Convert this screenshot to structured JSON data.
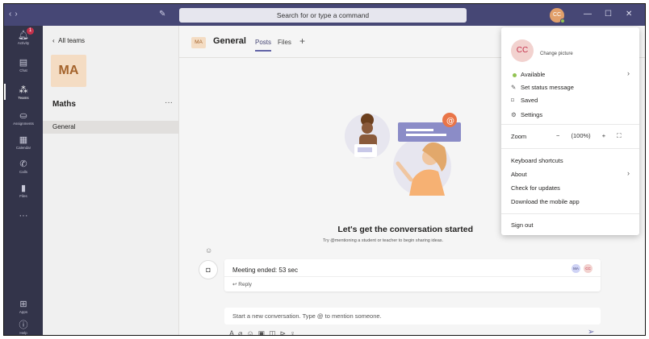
{
  "titlebar": {
    "back_icon": "chevron-left",
    "forward_icon": "chevron-right",
    "compose_icon": "new-chat",
    "search_placeholder": "Search for or type a command",
    "avatar_initials": "CC",
    "status_color": "#92c353"
  },
  "rail": {
    "items": [
      {
        "label": "Activity",
        "icon": "bell",
        "badge": "1"
      },
      {
        "label": "Chat",
        "icon": "chat"
      },
      {
        "label": "Teams",
        "icon": "teams",
        "active": true
      },
      {
        "label": "Assignments",
        "icon": "backpack"
      },
      {
        "label": "Calendar",
        "icon": "calendar"
      },
      {
        "label": "Calls",
        "icon": "phone"
      },
      {
        "label": "Files",
        "icon": "file"
      },
      {
        "label": "More",
        "icon": "ellipsis",
        "text": "···"
      }
    ],
    "bottom": [
      {
        "label": "Apps",
        "icon": "apps"
      },
      {
        "label": "Help",
        "icon": "help"
      }
    ]
  },
  "team_pane": {
    "back_label": "All teams",
    "team_initials": "MA",
    "team_name": "Maths",
    "more_label": "···",
    "channels": [
      "General"
    ]
  },
  "channel": {
    "initials": "MA",
    "title": "General",
    "tabs": [
      "Posts",
      "Files"
    ],
    "active_tab": "Posts",
    "add_tab_label": "+"
  },
  "empty_state": {
    "title": "Let's get the conversation started",
    "subtitle": "Try @mentioning a student or teacher to begin sharing ideas."
  },
  "conversation": {
    "meeting_text": "Meeting ended: 53 sec",
    "reply_label": "Reply",
    "participants": [
      "MA",
      "CC"
    ]
  },
  "compose": {
    "placeholder": "Start a new conversation. Type @ to mention someone."
  },
  "profile_menu": {
    "avatar_initials": "CC",
    "change_picture": "Change picture",
    "status": "Available",
    "set_status": "Set status message",
    "saved": "Saved",
    "settings": "Settings",
    "zoom_label": "Zoom",
    "zoom_minus": "−",
    "zoom_value": "(100%)",
    "zoom_plus": "+",
    "keyboard_shortcuts": "Keyboard shortcuts",
    "about": "About",
    "check_updates": "Check for updates",
    "download_app": "Download the mobile app",
    "sign_out": "Sign out"
  },
  "colors": {
    "titlebar": "#464775",
    "rail": "#33344a",
    "accent": "#6264a7",
    "team_tile": "#f4dcc3"
  }
}
